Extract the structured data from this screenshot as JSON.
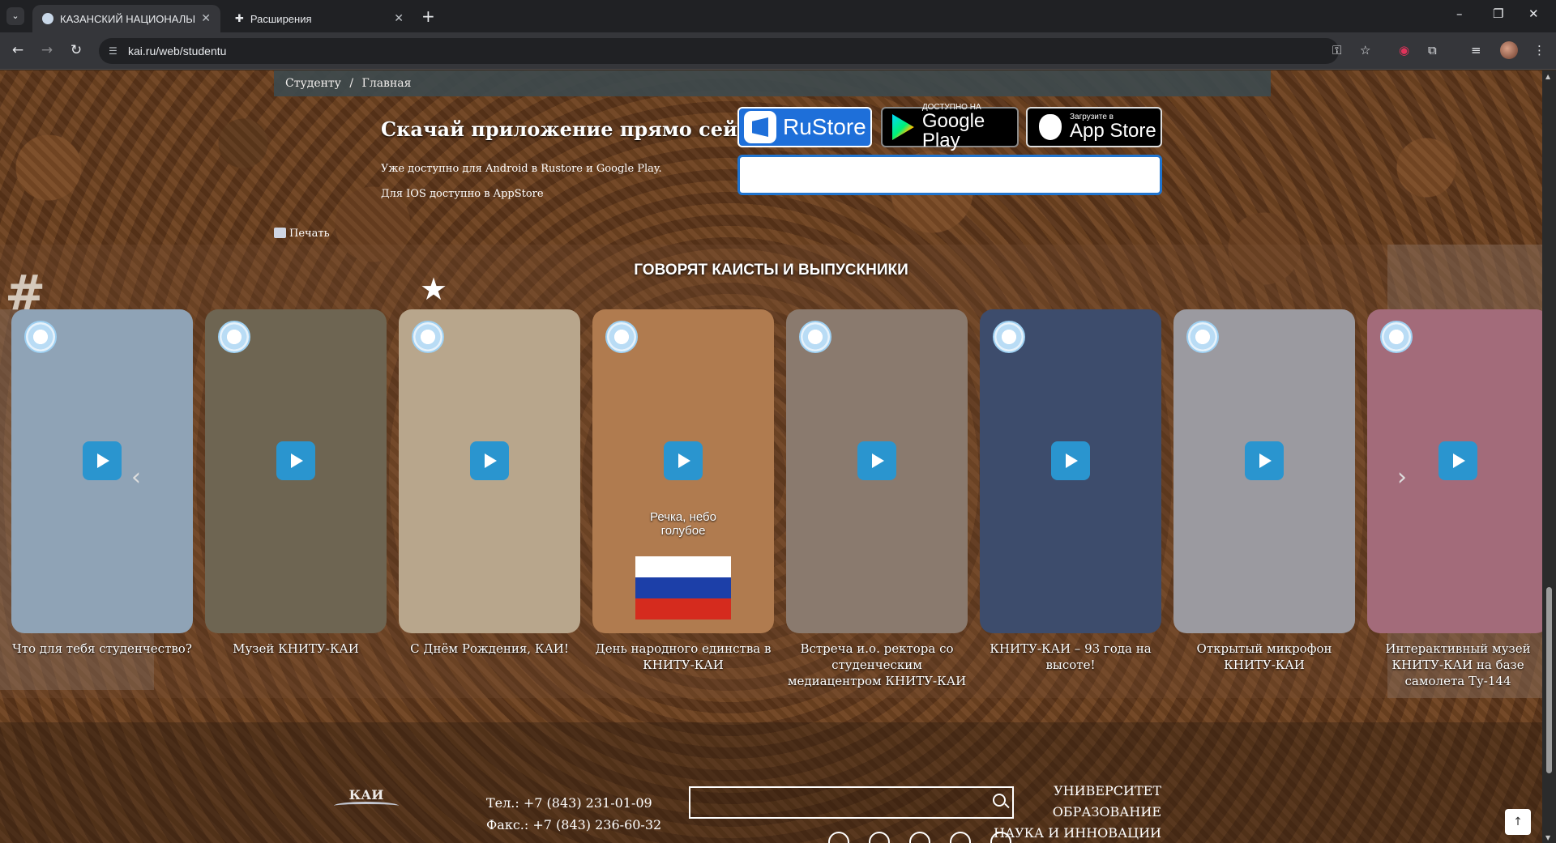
{
  "browser": {
    "tabs": [
      {
        "title": "КАЗАНСКИЙ НАЦИОНАЛЬНЫЙ",
        "close": "✕"
      },
      {
        "title": "Расширения",
        "close": "✕"
      }
    ],
    "new_tab": "+",
    "url": "kai.ru/web/studentu",
    "window": {
      "minimize": "–",
      "restore": "❐",
      "close": "✕"
    }
  },
  "breadcrumb": {
    "items": [
      "Студенту",
      "Главная"
    ],
    "sep": "/"
  },
  "app_promo": {
    "title": "Скачай приложение прямо сейчас",
    "line1": "Уже доступно для Android в Rustore и Google Play.",
    "line2": "Для IOS доступно в AppStore",
    "rustore": "RuStore",
    "google_small": "ДОСТУПНО НА",
    "google_big": "Google Play",
    "apple_small": "Загрузите в",
    "apple_big": "App Store"
  },
  "print_label": "Печать",
  "section_title": "ГОВОРЯТ КАИСТЫ И ВЫПУСКНИКИ",
  "videos": [
    {
      "caption": "Что для тебя студенчество?",
      "bg": "#8fa3b6"
    },
    {
      "caption": "Музей КНИТУ-КАИ",
      "bg": "#6e6552"
    },
    {
      "caption": "С Днём Рождения, КАИ!",
      "bg": "#b8a68c"
    },
    {
      "caption": "День народного единства в КНИТУ-КАИ",
      "bg": "#b07b4f",
      "overlay": "Речка, небо голубое"
    },
    {
      "caption": "Встреча и.о. ректора со студенческим медиацентром КНИТУ-КАИ",
      "bg": "#8a7a6e"
    },
    {
      "caption": "КНИТУ-КАИ – 93 года на высоте!",
      "bg": "#3d4c6c"
    },
    {
      "caption": "Открытый микрофон КНИТУ-КАИ",
      "bg": "#9b9aa0"
    },
    {
      "caption": "Интерактивный музей КНИТУ-КАИ на базе самолета Ту-144",
      "bg": "#a36b7a"
    }
  ],
  "footer": {
    "logo_text": "КАИ",
    "phone": "Тел.: +7 (843) 231-01-09",
    "fax": "Факс.: +7 (843) 236-60-32",
    "nav": [
      "УНИВЕРСИТЕТ",
      "ОБРАЗОВАНИЕ",
      "НАУКА И ИННОВАЦИИ"
    ],
    "to_top": "↑"
  },
  "colors": {
    "accent": "#1e6fd9",
    "play": "#2a95cf"
  }
}
